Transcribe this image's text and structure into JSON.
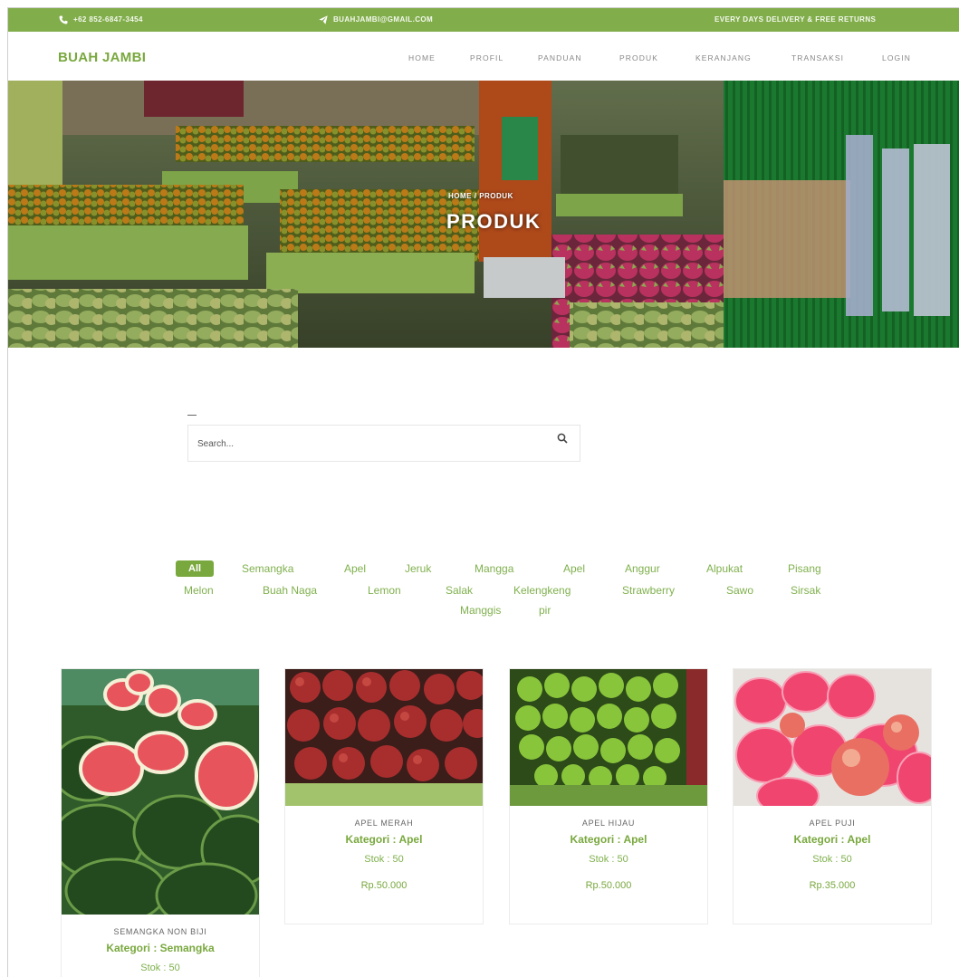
{
  "topbar": {
    "phone": "+62 852-6847-3454",
    "email": "BUAHJAMBI@GMAIL.COM",
    "promo": "EVERY DAYS DELIVERY & FREE RETURNS"
  },
  "brand": "BUAH JAMBI",
  "nav": [
    "HOME",
    "PROFIL",
    "PANDUAN",
    "PRODUK",
    "KERANJANG",
    "TRANSAKSI",
    "LOGIN"
  ],
  "hero": {
    "breadcrumb_home": "HOME",
    "breadcrumb_current": "PRODUK",
    "title": "PRODUK"
  },
  "search": {
    "placeholder": "Search..."
  },
  "filters": [
    "All",
    "Semangka",
    "Apel",
    "Jeruk",
    "Mangga",
    "Apel",
    "Anggur",
    "Alpukat",
    "Pisang",
    "Melon",
    "Buah Naga",
    "Lemon",
    "Salak",
    "Kelengkeng",
    "Strawberry",
    "Sawo",
    "Sirsak",
    "Manggis",
    "pir"
  ],
  "products": [
    {
      "name": "SEMANGKA NON BIJI",
      "category": "Kategori : Semangka",
      "stock": "Stok : 50",
      "price": ""
    },
    {
      "name": "APEL MERAH",
      "category": "Kategori : Apel",
      "stock": "Stok : 50",
      "price": "Rp.50.000"
    },
    {
      "name": "APEL HIJAU",
      "category": "Kategori : Apel",
      "stock": "Stok : 50",
      "price": "Rp.50.000"
    },
    {
      "name": "APEL PUJI",
      "category": "Kategori : Apel",
      "stock": "Stok : 50",
      "price": "Rp.35.000"
    }
  ],
  "colors": {
    "brand_green": "#79a83e",
    "topbar_green": "#81ad4b",
    "filter_text": "#7fb04d"
  },
  "icons": [
    "phone-icon",
    "send-icon",
    "search-icon"
  ]
}
